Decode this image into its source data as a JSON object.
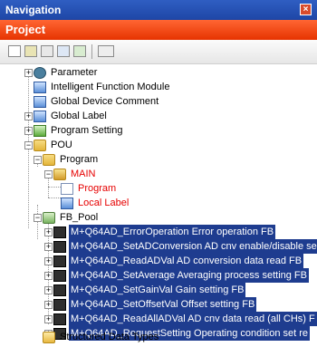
{
  "panel": {
    "title": "Navigation",
    "section": "Project"
  },
  "tree": {
    "items": [
      {
        "label": "Parameter",
        "icon": "parameter-icon"
      },
      {
        "label": "Intelligent Function Module",
        "icon": "module-icon"
      },
      {
        "label": "Global Device Comment",
        "icon": "comment-icon"
      },
      {
        "label": "Global Label",
        "icon": "label-icon"
      },
      {
        "label": "Program Setting",
        "icon": "program-setting-icon"
      },
      {
        "label": "POU",
        "icon": "folder-icon"
      },
      {
        "label": "Program",
        "icon": "folder-icon"
      },
      {
        "label": "MAIN",
        "icon": "program-main-icon"
      },
      {
        "label": "Program",
        "icon": "program-body-icon"
      },
      {
        "label": "Local Label",
        "icon": "local-label-icon"
      },
      {
        "label": "FB_Pool",
        "icon": "fb-pool-icon"
      },
      {
        "label": "M+Q64AD_ErrorOperation Error operation FB",
        "icon": "fb-icon"
      },
      {
        "label": "M+Q64AD_SetADConversion AD cnv enable/disable se",
        "icon": "fb-icon"
      },
      {
        "label": "M+Q64AD_ReadADVal AD conversion data read FB",
        "icon": "fb-icon"
      },
      {
        "label": "M+Q64AD_SetAverage Averaging process setting FB",
        "icon": "fb-icon"
      },
      {
        "label": "M+Q64AD_SetGainVal Gain setting FB",
        "icon": "fb-icon"
      },
      {
        "label": "M+Q64AD_SetOffsetVal Offset setting FB",
        "icon": "fb-icon"
      },
      {
        "label": "M+Q64AD_ReadAllADVal AD cnv data read (all CHs) F",
        "icon": "fb-icon"
      },
      {
        "label": "M+Q64AD_RequestSetting Operating condition set re",
        "icon": "fb-icon"
      },
      {
        "label": "Structured Data Types",
        "icon": "structured-data-icon"
      }
    ]
  },
  "colors": {
    "title_bar": "#1e46a6",
    "project_bar": "#f04a10",
    "selection": "#1e3c8f",
    "red_text": "#e60000"
  }
}
